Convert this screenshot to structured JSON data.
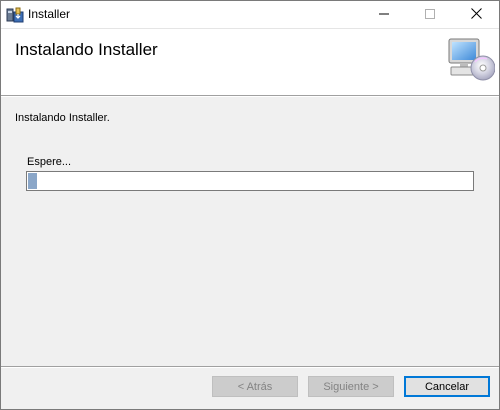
{
  "window": {
    "title": "Installer",
    "icon": "installer-app-icon",
    "controls": {
      "minimize": "minimize-icon",
      "maximize": "maximize-icon",
      "close": "close-icon"
    }
  },
  "banner": {
    "title": "Instalando Installer",
    "icon": "computer-cd-icon"
  },
  "content": {
    "status": "Instalando Installer.",
    "wait_label": "Espere...",
    "progress": 0.02
  },
  "buttons": {
    "back": "< Atrás",
    "next": "Siguiente >",
    "cancel": "Cancelar"
  },
  "colors": {
    "progress_fill": "#8aa6c8",
    "focus_border": "#0078d7"
  }
}
